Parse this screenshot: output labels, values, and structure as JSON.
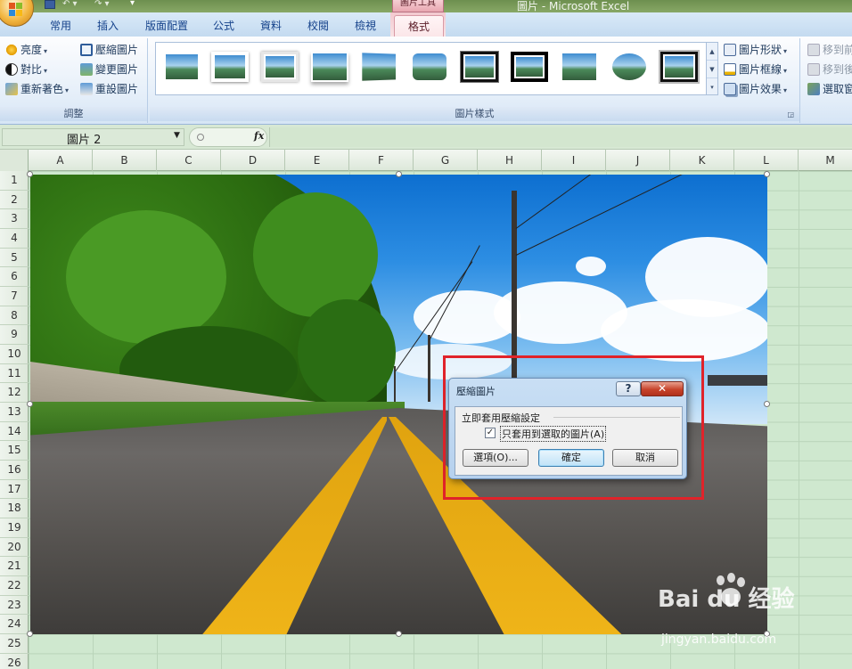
{
  "window": {
    "context_tab_group": "圖片工具",
    "title": "圖片 - Microsoft Excel"
  },
  "tabs": [
    "常用",
    "插入",
    "版面配置",
    "公式",
    "資料",
    "校閱",
    "檢視",
    "格式"
  ],
  "active_tab": "格式",
  "ribbon": {
    "adjust": {
      "label": "調整",
      "brightness": "亮度",
      "contrast": "對比",
      "recolor": "重新著色",
      "compress": "壓縮圖片",
      "change_picture": "變更圖片",
      "reset_picture": "重設圖片"
    },
    "styles": {
      "label": "圖片樣式",
      "picture_shape": "圖片形狀",
      "picture_border": "圖片框線",
      "picture_effects": "圖片效果"
    },
    "arrange": {
      "bring_forward": "移到前",
      "send_backward": "移到後",
      "selection_pane": "選取窗"
    }
  },
  "formula_bar": {
    "name_box": "圖片 2",
    "fx": "fx"
  },
  "columns": [
    "A",
    "B",
    "C",
    "D",
    "E",
    "F",
    "G",
    "H",
    "I",
    "J",
    "K",
    "L",
    "M"
  ],
  "rows": [
    "1",
    "2",
    "3",
    "4",
    "5",
    "6",
    "7",
    "8",
    "9",
    "10",
    "11",
    "12",
    "13",
    "14",
    "15",
    "16",
    "17",
    "18",
    "19",
    "20",
    "21",
    "22",
    "23",
    "24",
    "25",
    "26"
  ],
  "dialog": {
    "title": "壓縮圖片",
    "help": "?",
    "close": "✕",
    "group_label": "立即套用壓縮設定",
    "checkbox_label": "只套用到選取的圖片(A)",
    "checkbox_checked": true,
    "options_button": "選項(O)...",
    "ok_button": "確定",
    "cancel_button": "取消"
  },
  "watermark": {
    "brand": "Bai du 经验",
    "url": "jingyan.baidu.com"
  },
  "colors": {
    "highlight_border": "#e0232a",
    "sheet_background": "#cfe8cf",
    "context_tab": "#f3c8cf"
  }
}
